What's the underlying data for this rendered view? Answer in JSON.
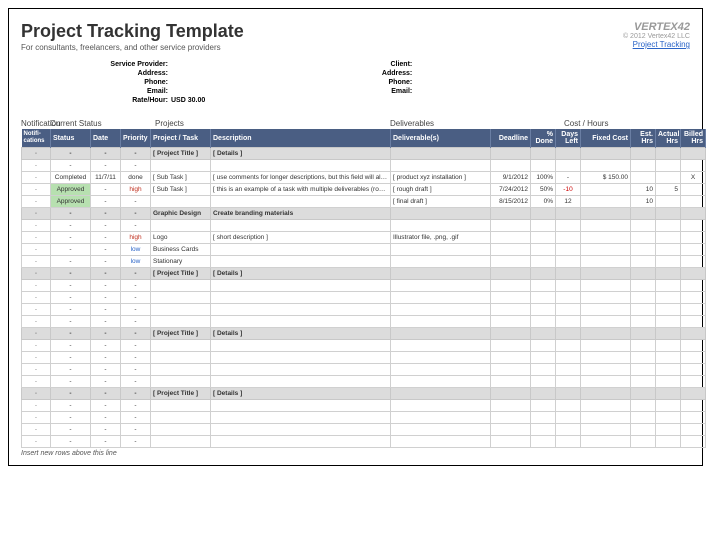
{
  "header": {
    "title": "Project Tracking Template",
    "subtitle": "For consultants, freelancers, and other service providers",
    "brand_name": "VERTEX42",
    "copyright": "© 2012 Vertex42 LLC",
    "link_text": "Project Tracking"
  },
  "provider": {
    "labels": {
      "sp": "Service Provider:",
      "addr": "Address:",
      "phone": "Phone:",
      "email": "Email:",
      "rate": "Rate/Hour:"
    },
    "rate": "USD 30.00"
  },
  "client": {
    "labels": {
      "client": "Client:",
      "addr": "Address:",
      "phone": "Phone:",
      "email": "Email:"
    }
  },
  "sections": {
    "notif": "Notification",
    "status": "Current Status",
    "projects": "Projects",
    "deliv": "Deliverables",
    "cost": "Cost / Hours"
  },
  "cols": {
    "notif": "Notifi-cations",
    "status": "Status",
    "date": "Date",
    "priority": "Priority",
    "task": "Project / Task",
    "desc": "Description",
    "deliv": "Deliverable(s)",
    "deadline": "Deadline",
    "pct": "% Done",
    "days": "Days Left",
    "fixed": "Fixed Cost",
    "est": "Est. Hrs",
    "actual": "Actual Hrs",
    "billed": "Billed Hrs"
  },
  "rows": [
    {
      "type": "section",
      "task": "[ Project Title ]",
      "desc": "[ Details ]"
    },
    {
      "type": "blank"
    },
    {
      "type": "data",
      "status": "Completed",
      "date": "11/7/11",
      "priority": "done",
      "task": "[ Sub Task ]",
      "desc": "[ use comments for longer descriptions, but this field will also wrap ]",
      "deliv": "[ product xyz installation ]",
      "deadline": "9/1/2012",
      "pct": "100%",
      "days": "-",
      "fixed": "$    150.00",
      "billed": "X"
    },
    {
      "type": "data",
      "status": "Approved",
      "status_cls": "approved",
      "priority": "high",
      "priority_cls": "high",
      "task": "[ Sub Task ]",
      "desc": "[ this is an example of a task with multiple deliverables (rough and final drafts) ]",
      "deliv": "[ rough draft ]",
      "deadline": "7/24/2012",
      "pct": "50%",
      "days": "-10",
      "days_cls": "neg",
      "est": "10",
      "actual": "5"
    },
    {
      "type": "data",
      "status": "Approved",
      "status_cls": "approved",
      "deliv": "[ final draft ]",
      "deadline": "8/15/2012",
      "pct": "0%",
      "days": "12",
      "est": "10"
    },
    {
      "type": "section",
      "task": "Graphic Design",
      "desc": "Create branding materials"
    },
    {
      "type": "blank"
    },
    {
      "type": "data",
      "priority": "high",
      "priority_cls": "high",
      "task": "Logo",
      "desc": "[ short description ]",
      "deliv": "Illustrator file, .png, .gif"
    },
    {
      "type": "data",
      "priority": "low",
      "priority_cls": "low",
      "task": "Business Cards"
    },
    {
      "type": "data",
      "priority": "low",
      "priority_cls": "low",
      "task": "Stationary"
    },
    {
      "type": "section",
      "task": "[ Project Title ]",
      "desc": "[ Details ]"
    },
    {
      "type": "blank"
    },
    {
      "type": "blank"
    },
    {
      "type": "blank"
    },
    {
      "type": "blank"
    },
    {
      "type": "section",
      "task": "[ Project Title ]",
      "desc": "[ Details ]"
    },
    {
      "type": "blank"
    },
    {
      "type": "blank"
    },
    {
      "type": "blank"
    },
    {
      "type": "blank"
    },
    {
      "type": "section",
      "task": "[ Project Title ]",
      "desc": "[ Details ]"
    },
    {
      "type": "blank"
    },
    {
      "type": "blank"
    },
    {
      "type": "blank"
    },
    {
      "type": "blank"
    }
  ],
  "footnote": "Insert new rows above this line"
}
